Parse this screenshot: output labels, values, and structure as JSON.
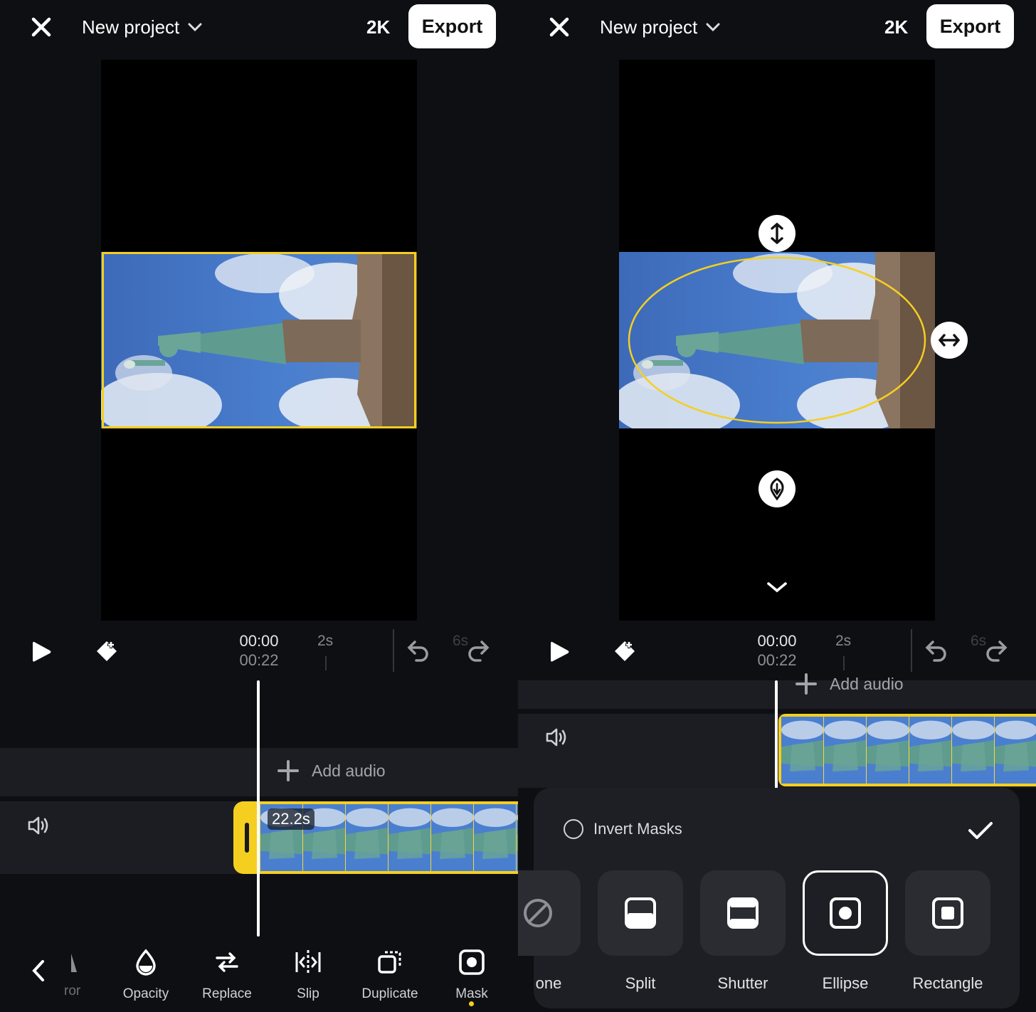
{
  "header": {
    "project_title": "New project",
    "resolution": "2K",
    "export_label": "Export"
  },
  "playback": {
    "current_time": "00:00",
    "total_time": "00:22",
    "tick_2s": "2s",
    "tick_6s": "6s"
  },
  "timeline": {
    "add_audio_label": "Add audio",
    "clip_duration": "22.2s"
  },
  "toolbar": {
    "partial_label": "ror",
    "items": [
      {
        "label": "Opacity",
        "icon": "opacity-icon"
      },
      {
        "label": "Replace",
        "icon": "replace-icon"
      },
      {
        "label": "Slip",
        "icon": "slip-icon"
      },
      {
        "label": "Duplicate",
        "icon": "duplicate-icon"
      },
      {
        "label": "Mask",
        "icon": "mask-icon"
      }
    ]
  },
  "mask_panel": {
    "invert_label": "Invert Masks",
    "options": [
      {
        "label": "one",
        "icon": "none-icon"
      },
      {
        "label": "Split",
        "icon": "split-icon"
      },
      {
        "label": "Shutter",
        "icon": "shutter-icon"
      },
      {
        "label": "Ellipse",
        "icon": "ellipse-icon",
        "selected": true
      },
      {
        "label": "Rectangle",
        "icon": "rectangle-icon"
      }
    ]
  },
  "colors": {
    "accent": "#f5cf1f",
    "background": "#0d0f13",
    "track": "#1b1d22",
    "sheet": "#1d1f24"
  }
}
